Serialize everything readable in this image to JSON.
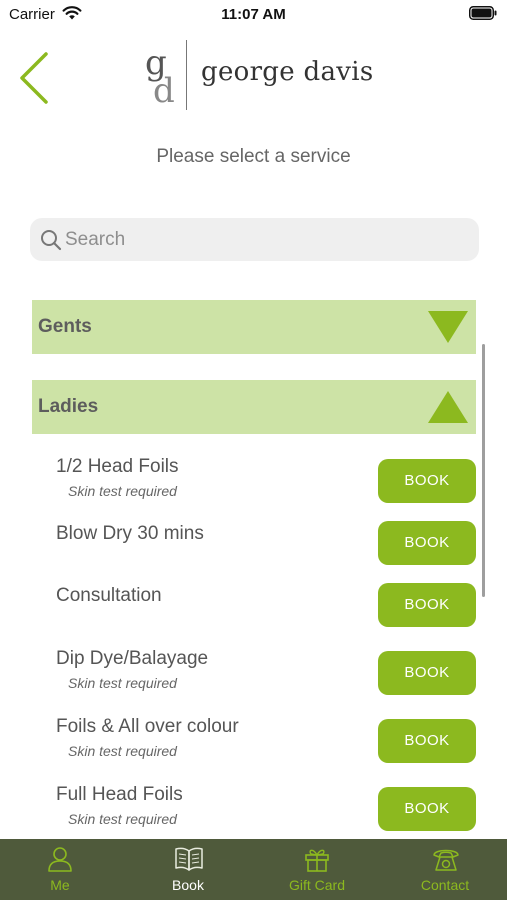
{
  "status_bar": {
    "carrier": "Carrier",
    "time": "11:07 AM"
  },
  "header": {
    "logo_mark": "gd",
    "logo_name": "george davis"
  },
  "page": {
    "subtitle": "Please select a service"
  },
  "search": {
    "placeholder": "Search",
    "value": ""
  },
  "categories": [
    {
      "label": "Gents",
      "expanded": false
    },
    {
      "label": "Ladies",
      "expanded": true
    }
  ],
  "services": [
    {
      "name": "1/2 Head Foils",
      "note": "Skin test required",
      "button": "BOOK"
    },
    {
      "name": "Blow Dry 30 mins",
      "note": "",
      "button": "BOOK"
    },
    {
      "name": "Consultation",
      "note": "",
      "button": "BOOK"
    },
    {
      "name": "Dip Dye/Balayage",
      "note": "Skin test required",
      "button": "BOOK"
    },
    {
      "name": "Foils & All over colour",
      "note": "Skin test required",
      "button": "BOOK"
    },
    {
      "name": "Full Head Foils",
      "note": "Skin test required",
      "button": "BOOK"
    }
  ],
  "tabs": [
    {
      "label": "Me",
      "icon": "person-icon"
    },
    {
      "label": "Book",
      "icon": "book-icon",
      "active": true
    },
    {
      "label": "Gift Card",
      "icon": "gift-icon"
    },
    {
      "label": "Contact",
      "icon": "phone-icon"
    }
  ],
  "colors": {
    "accent": "#8cb91f",
    "category_bg": "#cde3a6",
    "tab_bar_bg": "#4f5a3b"
  }
}
